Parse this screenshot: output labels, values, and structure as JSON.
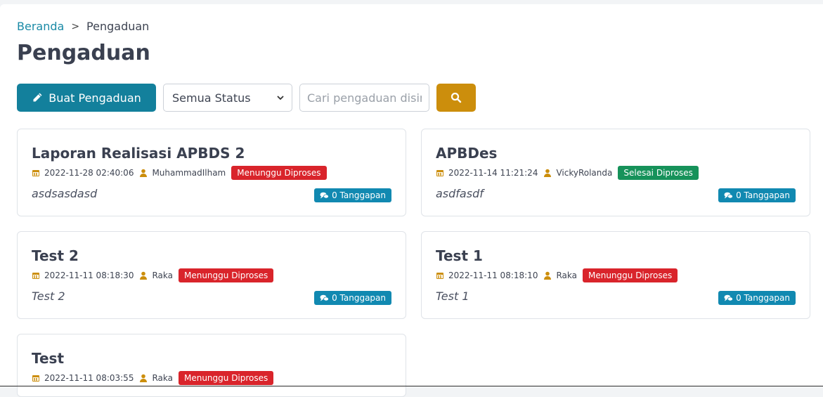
{
  "breadcrumb": {
    "home": "Beranda",
    "separator": ">",
    "current": "Pengaduan"
  },
  "page": {
    "title": "Pengaduan"
  },
  "toolbar": {
    "create_label": "Buat Pengaduan",
    "status_selected": "Semua Status",
    "search_placeholder": "Cari pengaduan disini"
  },
  "colors": {
    "primary": "#13809c",
    "search": "#cc8e0c",
    "accent_icon": "#cc8e0c",
    "badge_red": "#d9242b",
    "badge_green": "#16925a",
    "reply": "#1189b1"
  },
  "complaints": [
    {
      "title": "Laporan Realisasi APBDS 2",
      "date": "2022-11-28 02:40:06",
      "author": "MuhammadIlham",
      "status": "Menunggu Diproses",
      "status_type": "red",
      "description": "asdsasdasd",
      "replies": "0 Tanggapan"
    },
    {
      "title": "APBDes",
      "date": "2022-11-14 11:21:24",
      "author": "VickyRolanda",
      "status": "Selesai Diproses",
      "status_type": "green",
      "description": "asdfasdf",
      "replies": "0 Tanggapan"
    },
    {
      "title": "Test 2",
      "date": "2022-11-11 08:18:30",
      "author": "Raka",
      "status": "Menunggu Diproses",
      "status_type": "red",
      "description": "Test 2",
      "replies": "0 Tanggapan"
    },
    {
      "title": "Test 1",
      "date": "2022-11-11 08:18:10",
      "author": "Raka",
      "status": "Menunggu Diproses",
      "status_type": "red",
      "description": "Test 1",
      "replies": "0 Tanggapan"
    },
    {
      "title": "Test",
      "date": "2022-11-11 08:03:55",
      "author": "Raka",
      "status": "Menunggu Diproses",
      "status_type": "red",
      "description": "",
      "replies": ""
    }
  ]
}
